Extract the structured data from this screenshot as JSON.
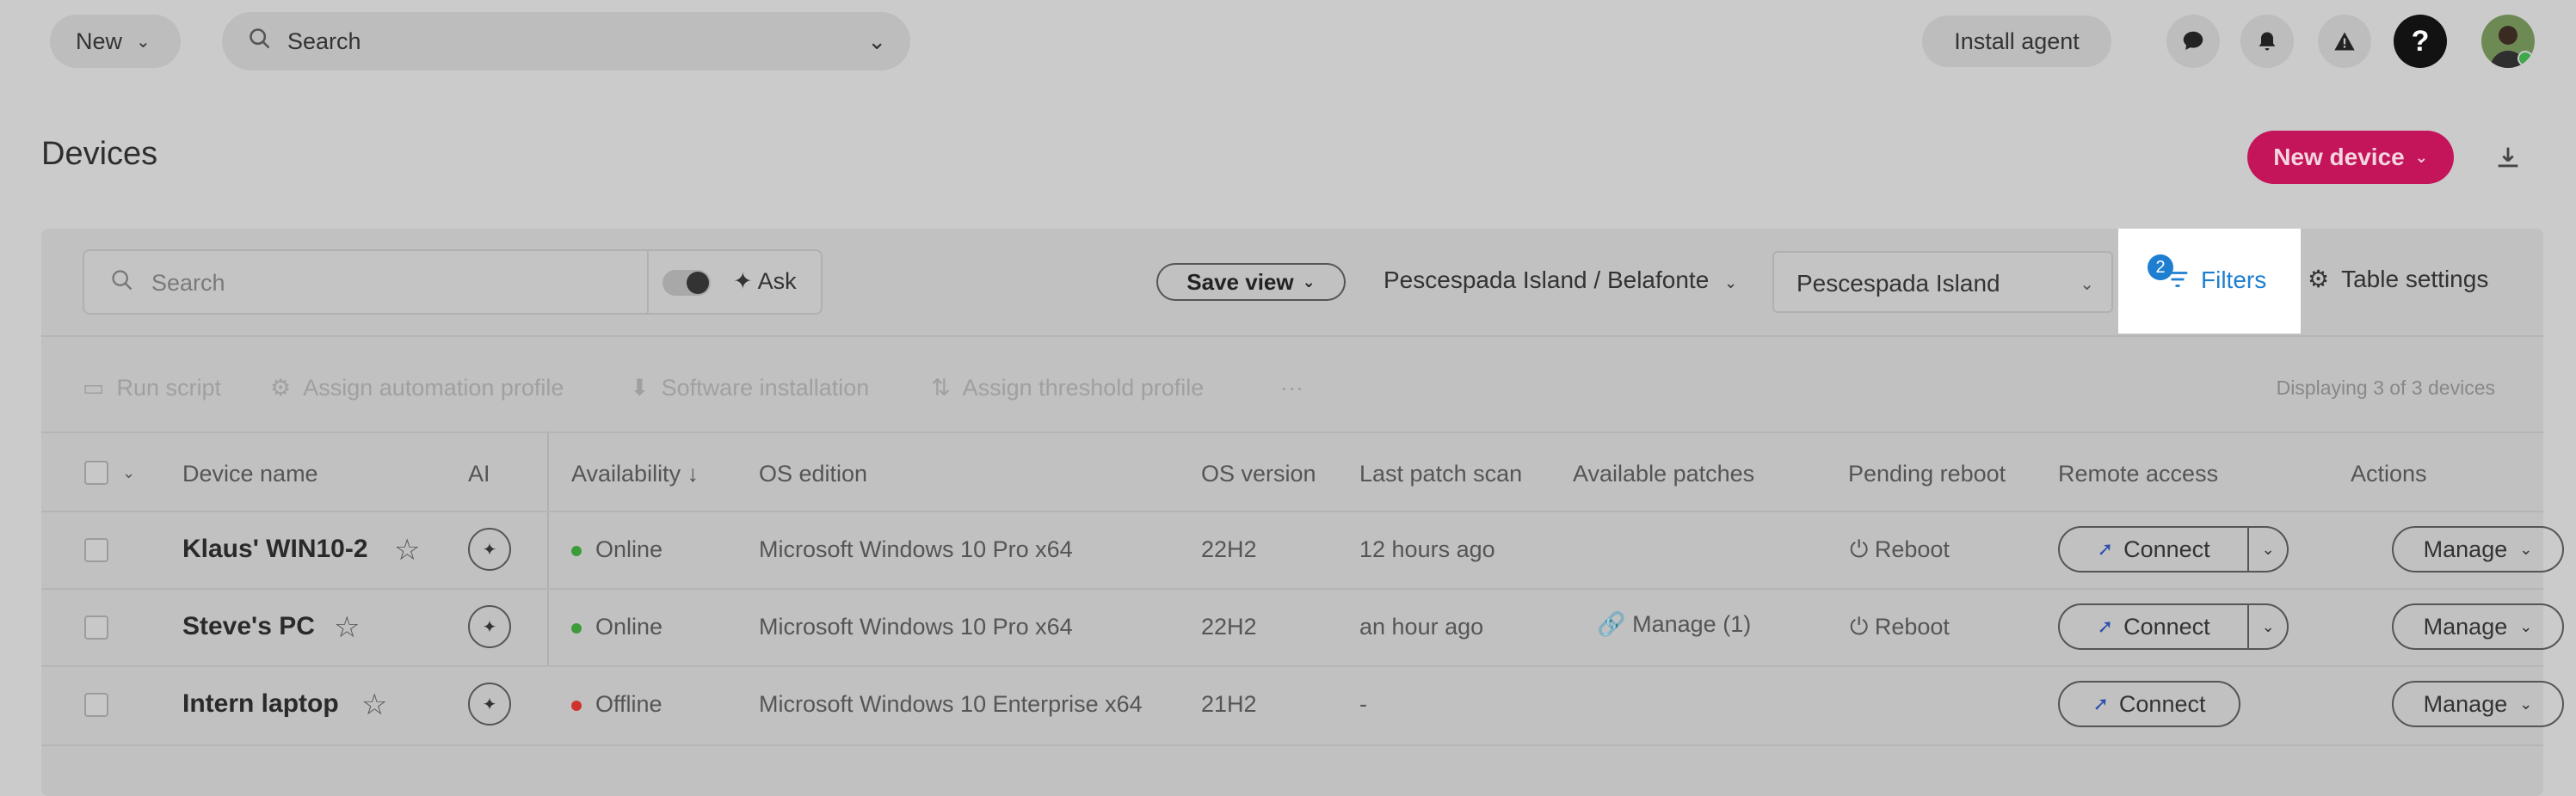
{
  "topbar": {
    "new_label": "New",
    "search_placeholder": "Search",
    "install_label": "Install agent",
    "help_label": "?"
  },
  "page": {
    "title": "Devices",
    "new_device_label": "New device"
  },
  "toolbar": {
    "search_placeholder": "Search",
    "ask_label": "Ask",
    "save_view_label": "Save view",
    "location_breadcrumb": "Pescespada Island / Belafonte",
    "location_select": "Pescespada Island",
    "filters_label": "Filters",
    "filters_count": "2",
    "table_settings_label": "Table settings"
  },
  "actions": {
    "run_script": "Run script",
    "assign_automation": "Assign automation profile",
    "software_installation": "Software installation",
    "assign_threshold": "Assign threshold profile",
    "more": "···",
    "displaying": "Displaying 3 of 3 devices"
  },
  "table": {
    "headers": {
      "device_name": "Device name",
      "ai": "AI",
      "availability": "Availability ↓",
      "os_edition": "OS edition",
      "os_version": "OS version",
      "last_patch_scan": "Last patch scan",
      "available_patches": "Available patches",
      "pending_reboot": "Pending reboot",
      "remote_access": "Remote access",
      "actions": "Actions"
    },
    "rows": [
      {
        "name": "Klaus' WIN10-2",
        "status": "Online",
        "status_color": "#3d9c3a",
        "os_edition": "Microsoft Windows 10 Pro x64",
        "os_version": "22H2",
        "last_scan": "12 hours ago",
        "patches": "",
        "reboot": "Reboot",
        "connect": "Connect",
        "manage": "Manage"
      },
      {
        "name": "Steve's PC",
        "status": "Online",
        "status_color": "#3d9c3a",
        "os_edition": "Microsoft Windows 10 Pro x64",
        "os_version": "22H2",
        "last_scan": "an hour ago",
        "patches": "Manage (1)",
        "reboot": "Reboot",
        "connect": "Connect",
        "manage": "Manage"
      },
      {
        "name": "Intern laptop",
        "status": "Offline",
        "status_color": "#d0322d",
        "os_edition": "Microsoft Windows 10 Enterprise x64",
        "os_version": "21H2",
        "last_scan": "-",
        "patches": "",
        "reboot": "",
        "connect": "Connect",
        "manage": "Manage"
      }
    ]
  }
}
